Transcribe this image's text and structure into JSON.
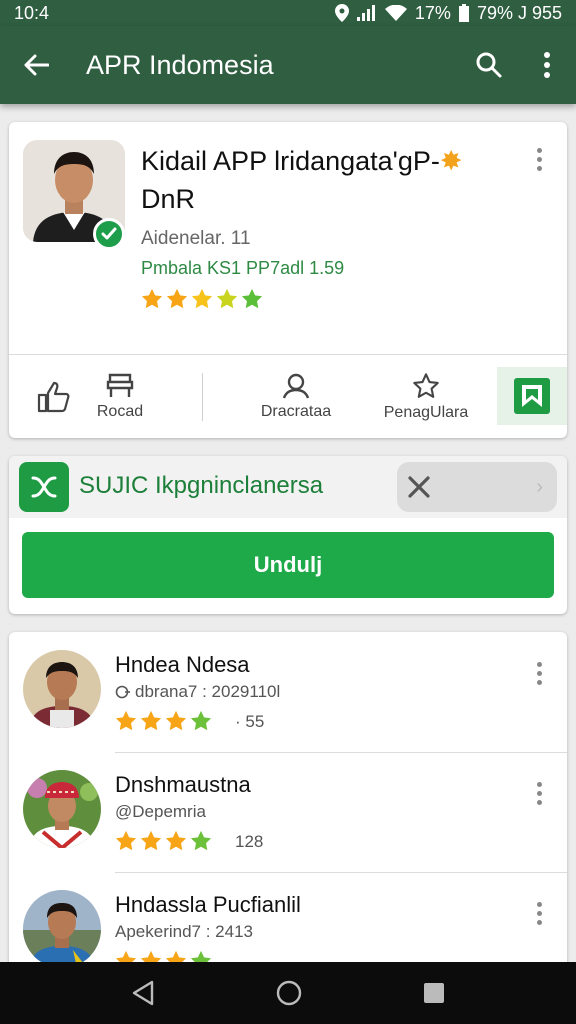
{
  "status_bar": {
    "time": "10:4",
    "battery": "17%",
    "right_text": "79% J 955"
  },
  "app_bar": {
    "title": "APR Indomesia",
    "back_icon": "arrow-left-icon",
    "search_icon": "search-icon",
    "menu_icon": "more-vertical-icon",
    "color": "#2f5e41"
  },
  "app_card": {
    "title": "Kidail APP lridangata'gP-",
    "title_line2": "DnR",
    "subtitle": "Aidenelar. 11",
    "meta": "Pmbala KS1 PP7adl 1.59",
    "rating_stars": 5,
    "actions": [
      {
        "label": "Rocad",
        "icon": "share-icon"
      },
      {
        "label": "Dracrataa",
        "icon": "person-icon"
      },
      {
        "label": "PenagUlara",
        "icon": "star-outline-icon"
      }
    ]
  },
  "install": {
    "promo_text": "SUJIC Ikpgninclanersa",
    "button_label": "Undulj",
    "accent": "#1faa4a"
  },
  "reviews": [
    {
      "name": "Hndea Ndesa",
      "meta": "dbrana7 : 2029110l",
      "count": "· 55",
      "stars": 4
    },
    {
      "name": "Dnshmaustna",
      "meta": "@Depemria",
      "count": "128",
      "stars": 4
    },
    {
      "name": "Hndassla Pucfianlil",
      "meta": "Apekerind7 : 2413",
      "count": "",
      "stars": 4
    }
  ]
}
